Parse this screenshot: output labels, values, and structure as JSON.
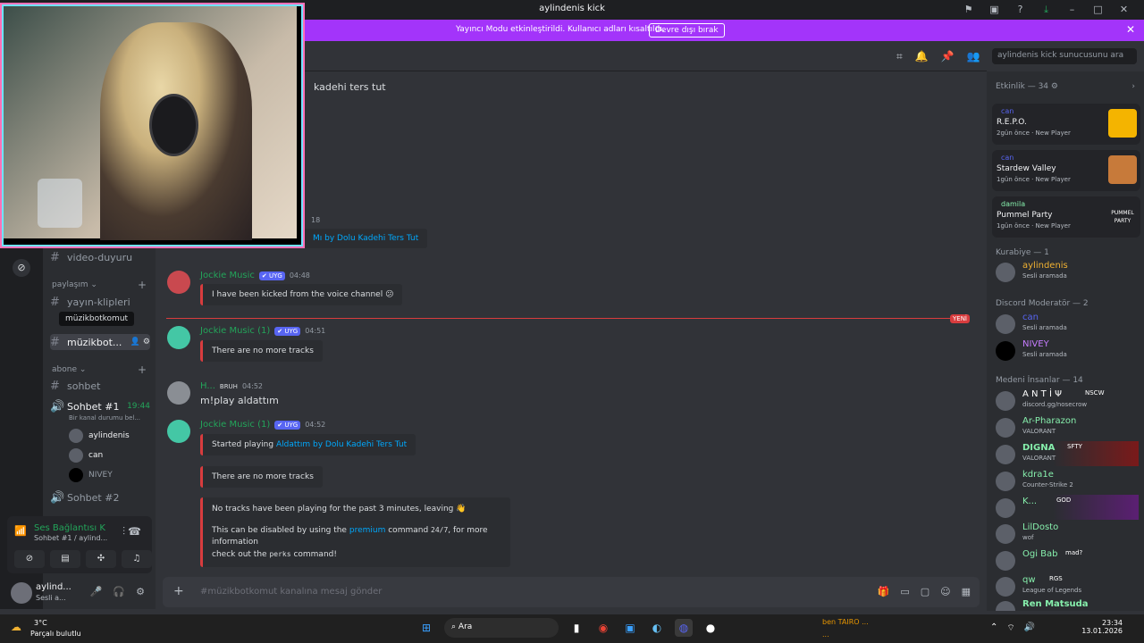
{
  "window": {
    "title": "aylindenis kick",
    "icons": [
      "inbox-icon",
      "window-icon",
      "help-icon",
      "download-icon",
      "minimize-icon",
      "maximize-icon",
      "close-icon"
    ]
  },
  "banner": {
    "text": "Yayıncı Modu etkinleştirildi. Kullanıcı adları kısaltıldı.",
    "button": "Devre dışı bırak",
    "close": "✕"
  },
  "sidebar": {
    "channels": [
      {
        "name": "video-duyuru"
      }
    ],
    "category_paylasim": "paylaşım",
    "paylasim_channels": [
      {
        "name": "yayın-klipleri"
      },
      {
        "name": "müzikbot..."
      }
    ],
    "tooltip": "müzikbotkomut",
    "category_abone": "abone",
    "abone_channels": [
      {
        "name": "sohbet"
      }
    ],
    "voice1": {
      "name": "Sohbet #1",
      "time": "19:44",
      "status": "Bir kanal durumu bel..."
    },
    "voice_users": [
      "aylindenis",
      "can",
      "NIVEY"
    ],
    "voice2": {
      "name": "Sohbet #2"
    },
    "vc_status": "Ses Bağlantısı K",
    "vc_sub": "Sohbet #1 / aylind...",
    "user": {
      "name": "aylind...",
      "status": "Sesli a..."
    }
  },
  "chat": {
    "top_text": "kadehi ters tut",
    "partial_time": "18",
    "partial_embed": "Mı by Dolu Kadehi Ters Tut",
    "messages": [
      {
        "author": "Jockie Music",
        "badge": "✔ UYG",
        "time": "04:48",
        "embed": "I have been kicked from the voice channel 😕"
      },
      {
        "author": "Jockie Music (1)",
        "badge": "✔ UYG",
        "time": "04:51",
        "embed": "There are no more tracks"
      },
      {
        "author": "H...",
        "badge": "BRUH",
        "time": "04:52",
        "text": "m!play aldattım"
      },
      {
        "author": "Jockie Music (1)",
        "badge": "✔ UYG",
        "time": "04:52",
        "embed1_prefix": "Started playing",
        "embed1_link": "Aldattım by Dolu Kadehi Ters Tut",
        "embed2": "There are no more tracks",
        "embed3_line1": "No tracks have been playing for the past 3 minutes, leaving 👋",
        "embed3_line2a": "This can be disabled by using the",
        "embed3_premium": "premium",
        "embed3_line2b": "command",
        "embed3_code1": "24/7",
        "embed3_line2c": ", for more information",
        "embed3_line3a": "check out the",
        "embed3_code2": "perks",
        "embed3_line3b": "command!"
      }
    ],
    "new_tag": "YENİ",
    "composer_placeholder": "#müzikbotkomut kanalına mesaj gönder"
  },
  "search": {
    "placeholder": "aylindenis kick sunucusunu ara"
  },
  "members": {
    "activity_head": "Etkinlik — 34 ⚙",
    "activities": [
      {
        "who": "can",
        "game": "R.E.P.O.",
        "meta": "2gün önce · New Player"
      },
      {
        "who": "can",
        "game": "Stardew Valley",
        "meta": "1gün önce · New Player"
      },
      {
        "who": "damila",
        "game": "Pummel Party",
        "meta": "1gün önce · New Player",
        "thumb_text": "PUMMEL PARTY"
      }
    ],
    "groups": [
      {
        "title": "Kurabiye — 1",
        "items": [
          {
            "name": "aylindenis",
            "status": "Sesli aramada",
            "color": "#f0b132"
          }
        ]
      },
      {
        "title": "Discord Moderatör — 2",
        "items": [
          {
            "name": "can",
            "status": "Sesli aramada",
            "color": "#5865f2"
          },
          {
            "name": "NIVEY",
            "status": "Sesli aramada",
            "color": "#c77dff"
          }
        ]
      },
      {
        "title": "Medeni İnsanlar — 14",
        "items": [
          {
            "name": "A N T İ Ψ",
            "status": "discord.gg/nosecrow",
            "color": "#ffffff",
            "tag": "NSCW"
          },
          {
            "name": "Ar-Pharazon",
            "status": "VALORANT",
            "color": "#86efac"
          },
          {
            "name": "DIGNA",
            "status": "VALORANT",
            "color": "#86efac",
            "tag": "SFTY"
          },
          {
            "name": "kdra1e",
            "status": "Counter-Strike 2",
            "color": "#86efac"
          },
          {
            "name": "K...",
            "status": "",
            "color": "#86efac",
            "tag": "GOD"
          },
          {
            "name": "LilDosto",
            "status": "wof",
            "color": "#86efac"
          },
          {
            "name": "Ogi Bab",
            "status": "",
            "color": "#86efac",
            "tag": "mad?"
          },
          {
            "name": "qw",
            "status": "League of Legends",
            "color": "#86efac",
            "tag": "RGS"
          },
          {
            "name": "Ren Matsuda",
            "status": "",
            "color": "#86efac"
          }
        ]
      }
    ]
  },
  "taskbar": {
    "weather_temp": "3°C",
    "weather_desc": "Parçalı bulutlu",
    "search": "Ara",
    "time": "23:34",
    "date": "13.01.2026",
    "marquee1": "ben TAIRO ...",
    "marquee2": "..."
  }
}
